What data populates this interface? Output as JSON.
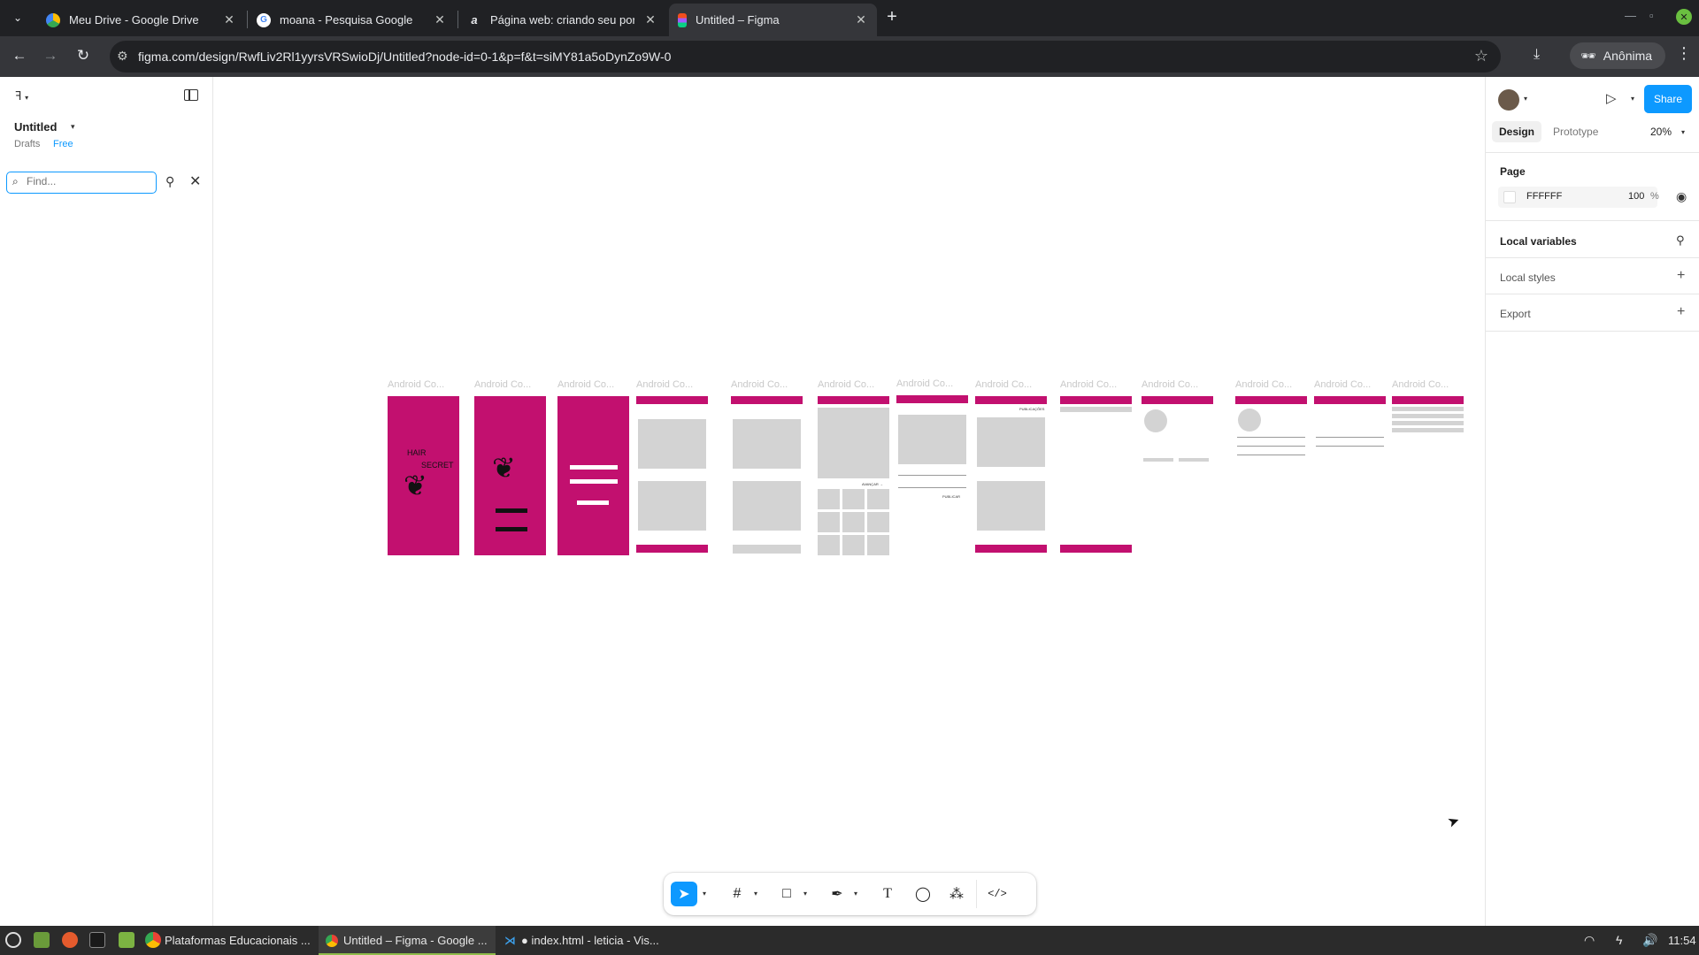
{
  "browser": {
    "tabs": [
      {
        "title": "Meu Drive - Google Drive",
        "icon": "google-drive-icon",
        "active": false
      },
      {
        "title": "moana - Pesquisa Google",
        "icon": "google-icon",
        "active": false
      },
      {
        "title": "Página web: criando seu por",
        "icon": "web-icon",
        "active": false
      },
      {
        "title": "Untitled – Figma",
        "icon": "figma-icon",
        "active": true
      }
    ],
    "url": "figma.com/design/RwfLiv2Rl1yyrsVRSwioDj/Untitled?node-id=0-1&p=f&t=siMY81a5oDynZo9W-0",
    "profile_label": "Anônima"
  },
  "left_panel": {
    "file_name": "Untitled",
    "location": "Drafts",
    "plan_badge": "Free",
    "find_placeholder": "Find..."
  },
  "canvas": {
    "frame_label": "Android Co...",
    "splash_logo_line1": "HAIR",
    "splash_logo_line2": "SECRET",
    "next_label": "AVANÇAR →",
    "publish_label": "PUBLICAR",
    "publications_label": "PUBLICAÇÕES"
  },
  "toolbar": {
    "tools": [
      "move-tool",
      "frame-tool",
      "rectangle-tool",
      "pen-tool",
      "text-tool",
      "comment-tool",
      "components-tool",
      "dev-mode-toggle"
    ]
  },
  "right_panel": {
    "share_label": "Share",
    "tab_design": "Design",
    "tab_prototype": "Prototype",
    "zoom": "20%",
    "page_section": "Page",
    "page_color": "FFFFFF",
    "page_opacity": "100",
    "percent_sign": "%",
    "local_variables": "Local variables",
    "local_styles": "Local styles",
    "export": "Export"
  },
  "taskbar": {
    "items": [
      {
        "label": "Plataformas Educacionais ...",
        "active": false
      },
      {
        "label": "Untitled – Figma - Google ...",
        "active": true
      },
      {
        "label": "● index.html - leticia - Vis...",
        "active": false
      }
    ],
    "clock": "11:54"
  },
  "colors": {
    "accent": "#0d99ff",
    "frame_pink": "#c2106f",
    "chrome_dark": "#202124",
    "chrome_toolbar": "#35363a"
  }
}
